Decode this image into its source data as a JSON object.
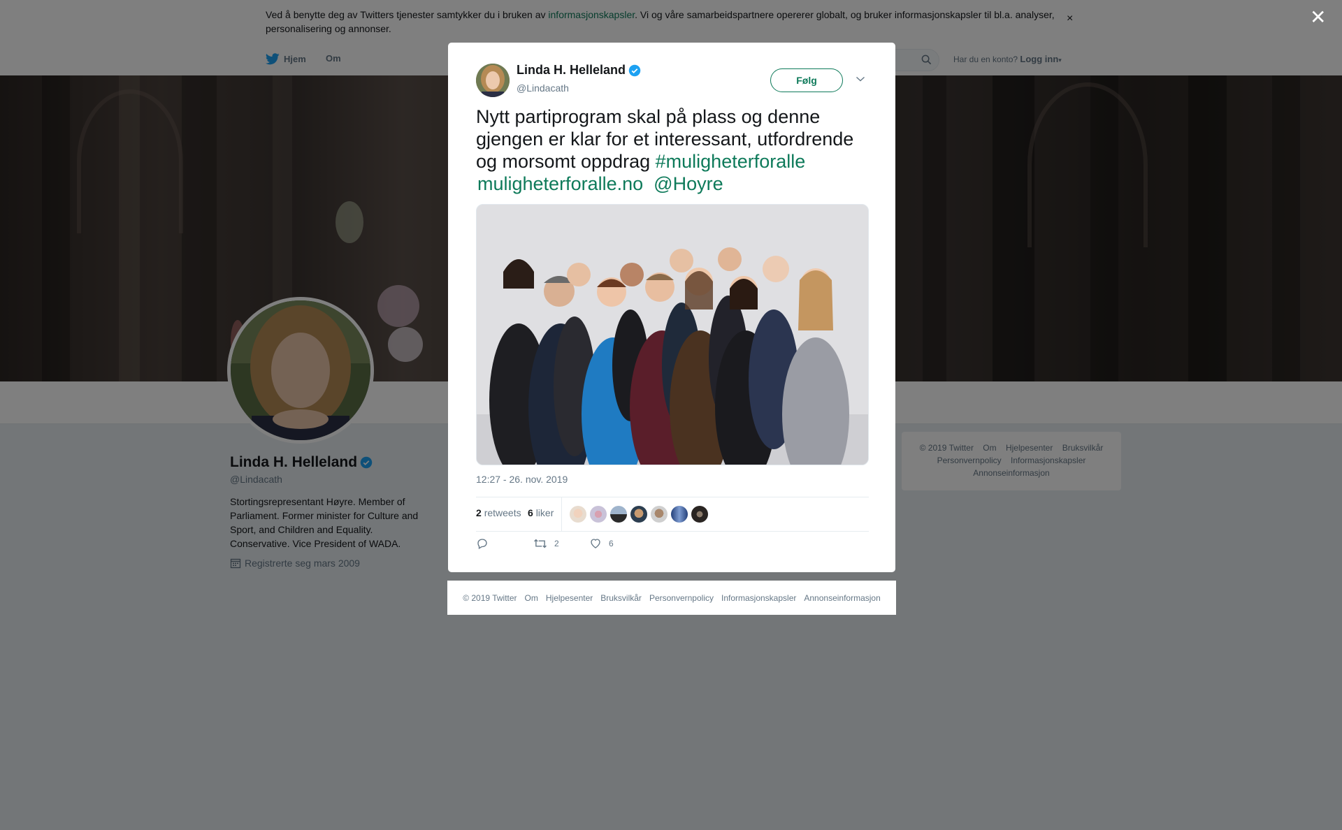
{
  "cookie_bar": {
    "text_before": "Ved å benytte deg av Twitters tjenester samtykker du i bruken av ",
    "link": "informasjonskapsler",
    "text_after": ". Vi og våre samarbeidspartnere opererer globalt, og bruker informasjonskapsler til bl.a. analyser, personalisering og annonser.",
    "close_glyph": "×"
  },
  "topnav": {
    "home": "Hjem",
    "about": "Om",
    "account_prompt": "Har du en konto?",
    "login": "Logg inn"
  },
  "profile": {
    "name": "Linda H. Helleland",
    "handle": "@Lindacath",
    "bio": "Stortingsrepresentant Høyre. Member of Parliament. Former minister for Culture and Sport, and Children and Equality. Conservative. Vice President of WADA.",
    "joined": "Registrerte seg mars 2009"
  },
  "right_footer": {
    "row1": [
      "© 2019 Twitter",
      "Om",
      "Hjelpesenter",
      "Bruksvilkår"
    ],
    "row2": [
      "Personvernpolicy",
      "Informasjonskapsler"
    ],
    "row3": [
      "Annonseinformasjon"
    ]
  },
  "overlay": {
    "close_glyph": "✕"
  },
  "tweet": {
    "author_name": "Linda H. Helleland",
    "author_handle": "@Lindacath",
    "follow_label": "Følg",
    "text": "Nytt partiprogram skal på plass og denne gjengen er klar for et interessant, utfordrende og morsomt oppdrag ",
    "hashtag": "#mulighetерforalle",
    "link": "muligheterforalle.no",
    "mention": "@Hoyre",
    "timestamp": "12:27 - 26. nov. 2019",
    "retweets_count": "2",
    "retweets_label": "retweets",
    "likes_count": "6",
    "likes_label": "liker",
    "action_reply_count": "",
    "action_retweet_count": "2",
    "action_like_count": "6"
  },
  "modal_footer": [
    "© 2019 Twitter",
    "Om",
    "Hjelpesenter",
    "Bruksvilkår",
    "Personvernpolicy",
    "Informasjonskapsler",
    "Annonseinformasjon"
  ],
  "colors": {
    "accent": "#0e7a5a",
    "verified": "#1da1f2",
    "muted": "#657786",
    "text": "#14171a"
  },
  "icons": {
    "verified": "verified-badge-icon",
    "twitter": "twitter-bird-icon",
    "search": "search-icon",
    "calendar": "calendar-icon",
    "reply": "reply-icon",
    "retweet": "retweet-icon",
    "like": "heart-icon",
    "caret": "chevron-down-icon"
  }
}
